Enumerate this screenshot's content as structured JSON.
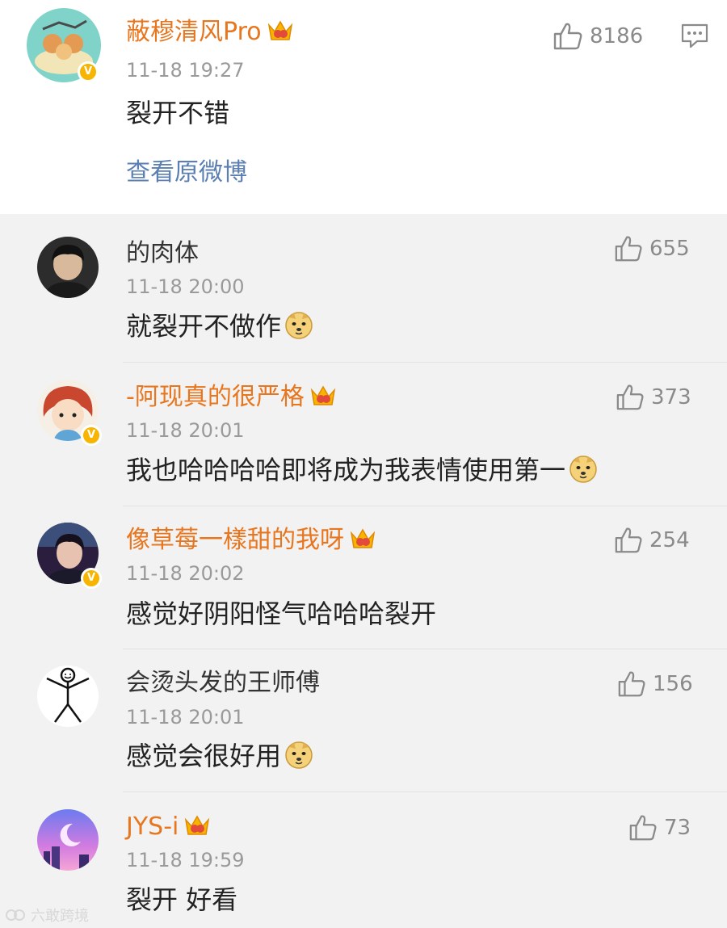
{
  "top_comment": {
    "username": "蔽穆清风Pro",
    "time": "11-18 19:27",
    "text": "裂开不错",
    "likes": "8186",
    "view_original": "查看原微博"
  },
  "replies": [
    {
      "username": "的肉体",
      "time": "11-18 20:00",
      "text": "就裂开不做作",
      "likes": "655"
    },
    {
      "username": "-阿现真的很严格",
      "time": "11-18 20:01",
      "text": "我也哈哈哈哈即将成为我表情使用第一",
      "likes": "373"
    },
    {
      "username": "像草莓一樣甜的我呀",
      "time": "11-18 20:02",
      "text": "感觉好阴阳怪气哈哈哈裂开",
      "likes": "254"
    },
    {
      "username": "会烫头发的王师傅",
      "time": "11-18 20:01",
      "text": "感觉会很好用",
      "likes": "156"
    },
    {
      "username": "JYS-i",
      "time": "11-18 19:59",
      "text": "裂开 好看",
      "likes": "73"
    }
  ],
  "watermark": "六敢跨境",
  "colors": {
    "vip_name": "#e8761e",
    "link": "#5b7fb2",
    "badge": "#f7b400"
  }
}
